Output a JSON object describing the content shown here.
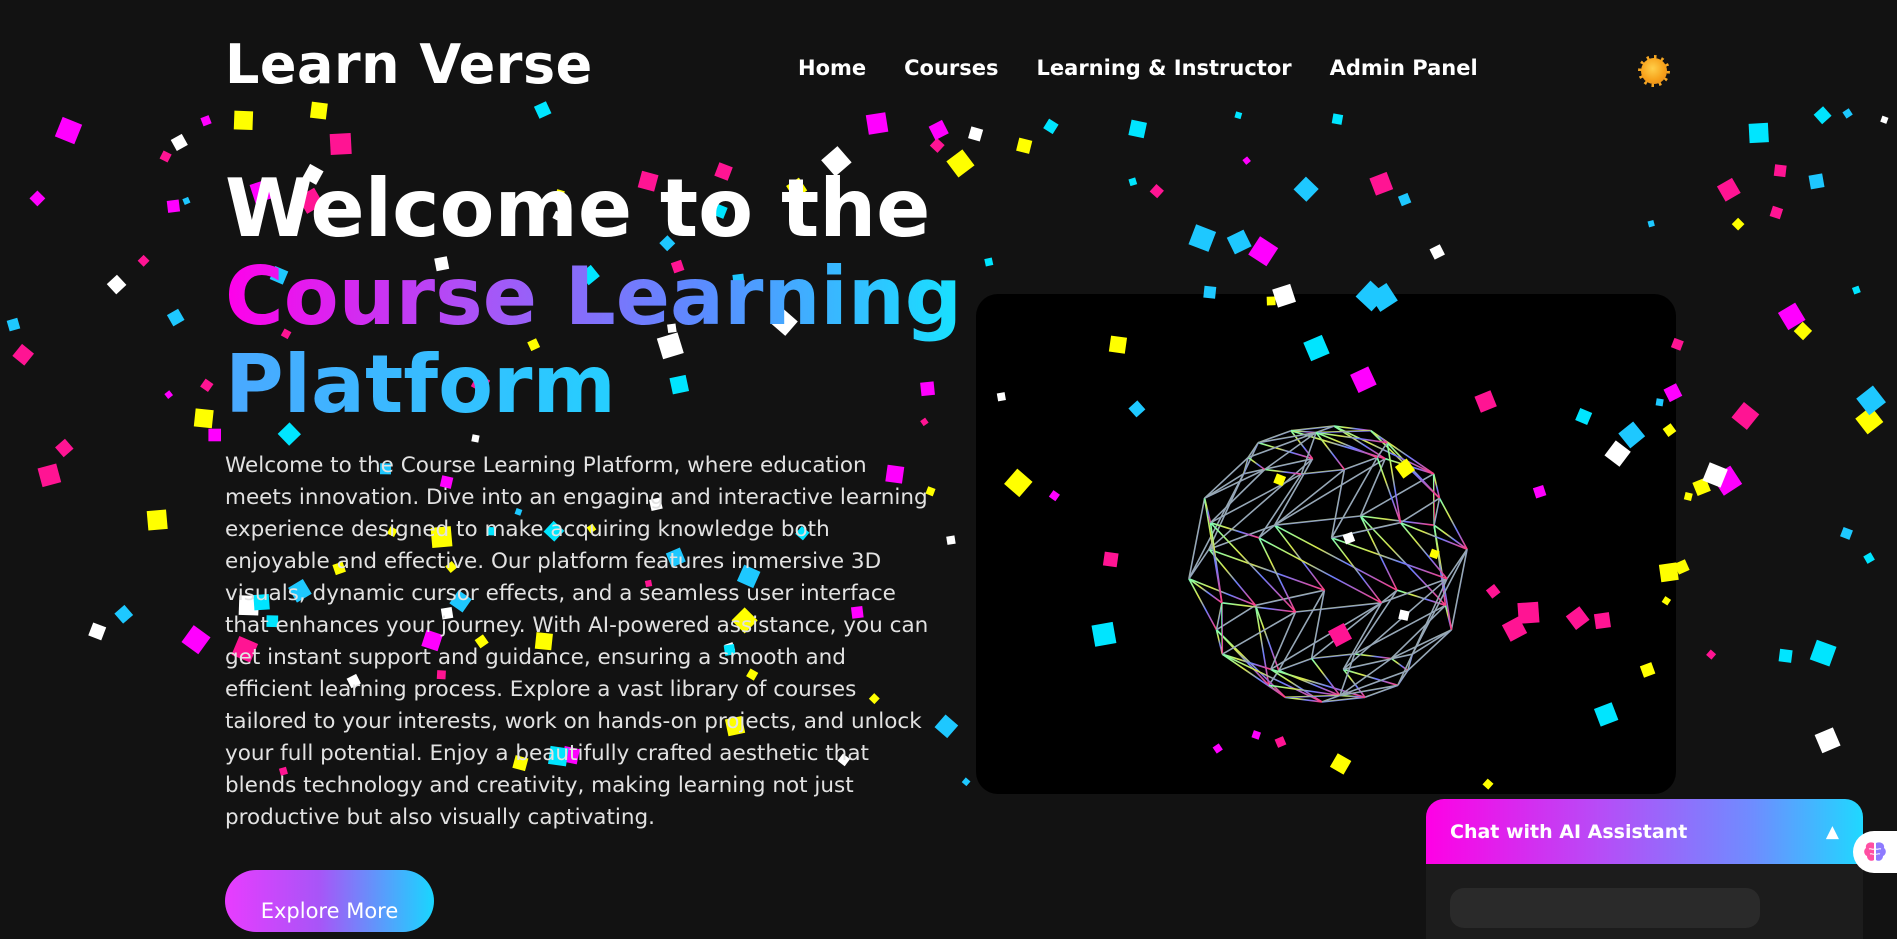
{
  "app": {
    "brand": "Learn Verse"
  },
  "nav": {
    "links": [
      "Home",
      "Courses",
      "Learning & Instructor",
      "Admin Panel"
    ],
    "theme_toggle_icon": "sun-icon"
  },
  "hero": {
    "title_line1": "Welcome to the",
    "title_line2": "Course Learning",
    "title_line3": "Platform",
    "description": "Welcome to the Course Learning Platform, where education meets innovation. Dive into an engaging and interactive learning experience designed to make acquiring knowledge both enjoyable and effective. Our platform features immersive 3D visuals, dynamic cursor effects, and a seamless user interface that enhances your journey. With AI-powered assistance, you can get instant support and guidance, ensuring a smooth and efficient learning process. Explore a vast library of courses tailored to your interests, work on hands-on projects, and unlock your full potential. Enjoy a beautifully crafted aesthetic that blends technology and creativity, making learning not just productive but also visually captivating.",
    "cta_label": "Explore More"
  },
  "visual": {
    "icon": "wireframe-sphere-icon"
  },
  "chat": {
    "title": "Chat with AI Assistant",
    "toggle_icon": "triangle-up-icon",
    "fab_icon": "brain-icon"
  },
  "colors": {
    "background": "#121212",
    "confetti": [
      "#ff1493",
      "#00e5ff",
      "#ffff00",
      "#ffffff",
      "#ff00ff",
      "#1ec8ff"
    ],
    "gradient_start": "#ff00ea",
    "gradient_end": "#17e2ff"
  }
}
